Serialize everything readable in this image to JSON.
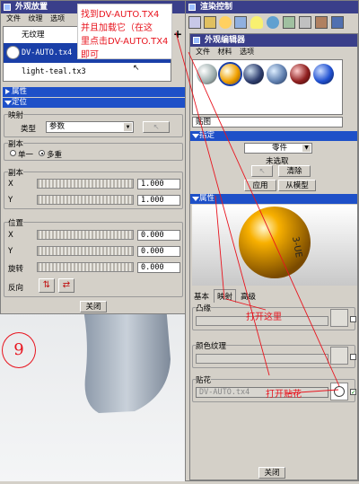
{
  "left_window": {
    "title": "外观放置",
    "menu": [
      "文件",
      "纹理",
      "选项"
    ],
    "texture_list": [
      {
        "name": "无纹理",
        "selected": false
      },
      {
        "name": "DV-AUTO.tx4",
        "selected": true
      },
      {
        "name": "light-teal.tx3",
        "selected": false
      }
    ],
    "add_icon_label": "+",
    "sections": {
      "properties": "属性",
      "placement": "定位"
    },
    "mapping_group": "映射",
    "type_label": "类型",
    "type_value": "参数",
    "copies_group": "副本",
    "single_label": "单一",
    "multi_label": "多重",
    "copies2_group": "副本",
    "x_label": "X",
    "y_label": "Y",
    "x_copies": "1.000",
    "y_copies": "1.000",
    "position_group": "位置",
    "pos_x": "0.000",
    "pos_y": "0.000",
    "rotation_label": "旋转",
    "rotation": "0.000",
    "reverse_label": "反向",
    "close_button": "关闭"
  },
  "right_windows": {
    "render_control_title": "渲染控制",
    "editor_title": "外观编辑器",
    "editor_menu": [
      "文件",
      "材料",
      "选项"
    ],
    "decal_field": "贴图",
    "assign_header": "指定",
    "assign_select": "零件",
    "not_selected": "未选取",
    "clear_button": "清除",
    "apply_button": "应用",
    "from_model_button": "从模型",
    "properties_header": "属性",
    "tabs": [
      "基本",
      "映射",
      "高级"
    ],
    "bump_group": "凸缘",
    "color_texture_group": "颜色纹理",
    "decal_group": "贴花",
    "decal_value": "DV-AUTO.tx4",
    "close_button": "关闭",
    "ball_text": "3-UE"
  },
  "annotations": {
    "instruction": [
      "找到DV-AUTO.TX4",
      "并且加载它（在这",
      "里点击DV-AUTO.TX4",
      "即可"
    ],
    "open_here": "打开这里",
    "open_decal": "打开贴花",
    "step_number": "9"
  },
  "colors": {
    "title_dark": "#3a3f8a",
    "blue_header": "#1e50c8",
    "ball_orange": "#f0a000",
    "annotation_red": "#e8141e"
  }
}
